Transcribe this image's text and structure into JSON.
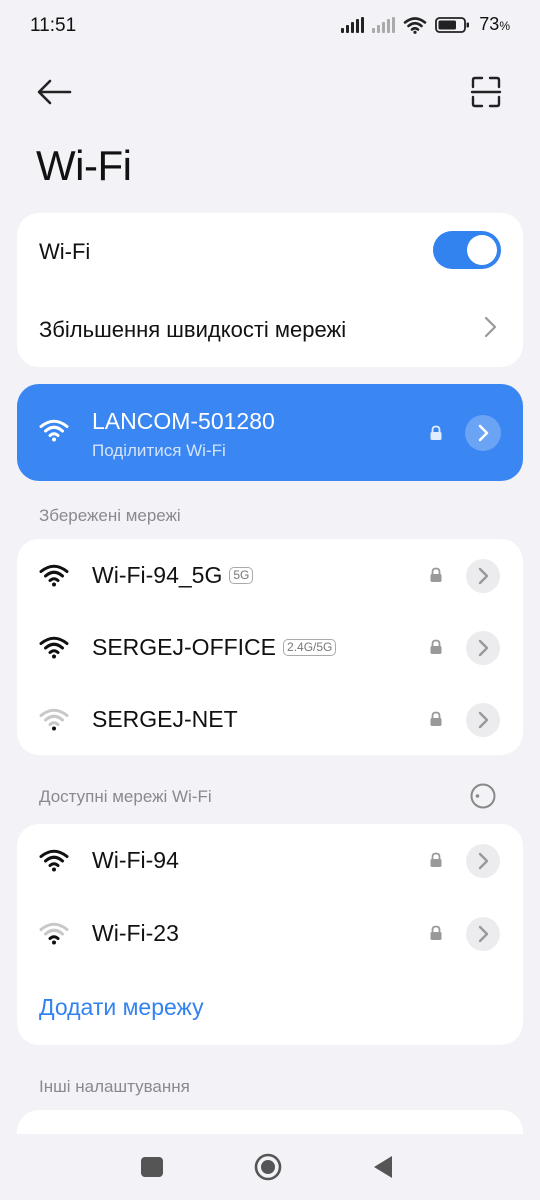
{
  "status_bar": {
    "time": "11:51",
    "battery_percent": "73",
    "battery_percent_suffix": "%",
    "battery_level": 0.73
  },
  "page": {
    "title": "Wi-Fi"
  },
  "wifi_card": {
    "toggle_label": "Wi-Fi",
    "toggle_on": true,
    "speed_boost_label": "Збільшення швидкості мережі"
  },
  "connected": {
    "name": "LANCOM-501280",
    "subtitle": "Поділитися Wi-Fi"
  },
  "saved": {
    "header": "Збережені мережі",
    "networks": [
      {
        "name": "Wi-Fi-94_5G",
        "badge": "5G",
        "signal": "strong"
      },
      {
        "name": "SERGEJ-OFFICE",
        "badge": "2.4G/5G",
        "signal": "strong"
      },
      {
        "name": "SERGEJ-NET",
        "badge": "",
        "signal": "weak"
      }
    ]
  },
  "available": {
    "header": "Доступні мережі Wi-Fi",
    "networks": [
      {
        "name": "Wi-Fi-94",
        "signal": "strong"
      },
      {
        "name": "Wi-Fi-23",
        "signal": "medium"
      }
    ],
    "add_label": "Додати мережу"
  },
  "other": {
    "header": "Інші налаштування"
  },
  "colors": {
    "accent": "#3282f0",
    "connected_bg": "#3a86f2",
    "background": "#f2f2f7"
  }
}
